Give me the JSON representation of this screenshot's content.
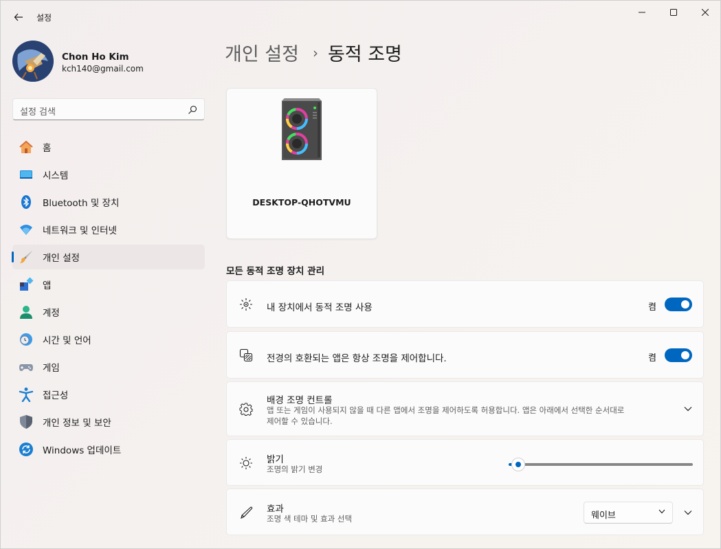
{
  "window": {
    "app_title": "설정",
    "controls": {
      "minimize": "minimize-icon",
      "maximize": "maximize-icon",
      "close": "close-icon"
    }
  },
  "profile": {
    "name": "Chon Ho Kim",
    "email": "kch140@gmail.com"
  },
  "search": {
    "placeholder": "설정 검색"
  },
  "sidebar": {
    "items": [
      {
        "label": "홈",
        "icon": "home-icon",
        "selected": false
      },
      {
        "label": "시스템",
        "icon": "system-icon",
        "selected": false
      },
      {
        "label": "Bluetooth 및 장치",
        "icon": "bluetooth-icon",
        "selected": false
      },
      {
        "label": "네트워크 및 인터넷",
        "icon": "wifi-icon",
        "selected": false
      },
      {
        "label": "개인 설정",
        "icon": "brush-icon",
        "selected": true
      },
      {
        "label": "앱",
        "icon": "apps-icon",
        "selected": false
      },
      {
        "label": "계정",
        "icon": "account-icon",
        "selected": false
      },
      {
        "label": "시간 및 언어",
        "icon": "clock-globe-icon",
        "selected": false
      },
      {
        "label": "게임",
        "icon": "gamepad-icon",
        "selected": false
      },
      {
        "label": "접근성",
        "icon": "accessibility-icon",
        "selected": false
      },
      {
        "label": "개인 정보 및 보안",
        "icon": "shield-icon",
        "selected": false
      },
      {
        "label": "Windows 업데이트",
        "icon": "update-icon",
        "selected": false
      }
    ],
    "accent": "#0067c0"
  },
  "main": {
    "breadcrumb": {
      "parent": "개인 설정",
      "separator": "›",
      "current": "동적 조명"
    },
    "device": {
      "name": "DESKTOP-QHOTVMU",
      "icon": "desktop-tower-icon"
    },
    "section_title": "모든 동적 조명 장치 관리",
    "settings": {
      "use_dynamic": {
        "title": "내 장치에서 동적 조명 사용",
        "state": "켬",
        "on": true,
        "icon": "lighting-icon"
      },
      "foreground_control": {
        "title": "전경의 호환되는 앱은 항상 조명을 제어합니다.",
        "state": "켬",
        "on": true,
        "icon": "layers-icon"
      },
      "background_control": {
        "title": "배경 조명 컨트롤",
        "subtitle_line1": "앱 또는 게임이 사용되지 않을 때 다른 앱에서 조명을 제어하도록 허용합니다. 앱은 아래에서 선택한 순서대로",
        "subtitle_line2": "제어할 수 있습니다.",
        "icon": "gear-icon"
      },
      "brightness": {
        "title": "밝기",
        "subtitle": "조명의 밝기 변경",
        "icon": "sun-icon",
        "value_fraction": 0.01
      },
      "effects": {
        "title": "효과",
        "subtitle": "조명 색 테마 및 효과 선택",
        "icon": "pen-icon",
        "selected": "웨이브"
      }
    }
  }
}
